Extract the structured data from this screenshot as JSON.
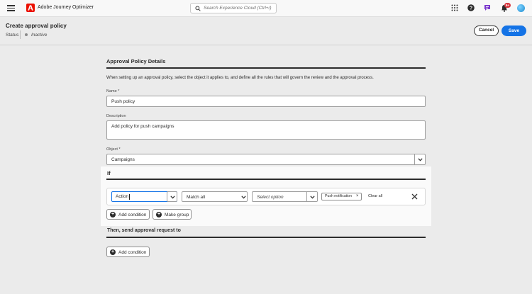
{
  "app": {
    "name": "Adobe Journey Optimizer"
  },
  "search": {
    "placeholder": "Search Experience Cloud (Ctrl+/)"
  },
  "topbar_icons": [
    "grid-icon",
    "help-icon",
    "chat-icon",
    "bell-icon",
    "avatar"
  ],
  "notifications": {
    "badge": "9+"
  },
  "header": {
    "title": "Create approval policy",
    "status_label": "Status",
    "status_value": "Inactive",
    "cancel_label": "Cancel",
    "save_label": "Save"
  },
  "form": {
    "section_title": "Approval Policy Details",
    "description": "When setting up an approval policy, select the object it applies to, and define all the rules that will govern the review and the approval process.",
    "name_label": "Name",
    "name_value": "Push policy",
    "description_label": "Description",
    "description_value": "Add policy for push campaigns",
    "object_label": "Object",
    "object_value": "Campaigns",
    "required_marker": "*"
  },
  "if_section": {
    "title": "If",
    "condition": {
      "field_value": "Action",
      "match_value": "Match all",
      "option_placeholder": "Select option",
      "tag": "Push notification",
      "clear_all": "Clear all"
    },
    "add_condition_label": "Add condition",
    "make_group_label": "Make group"
  },
  "then_section": {
    "title": "Then, send approval request to",
    "add_condition_label": "Add condition"
  },
  "colors": {
    "accent": "#1473e6",
    "brand": "#eb1000",
    "text": "#2c2c2c"
  }
}
